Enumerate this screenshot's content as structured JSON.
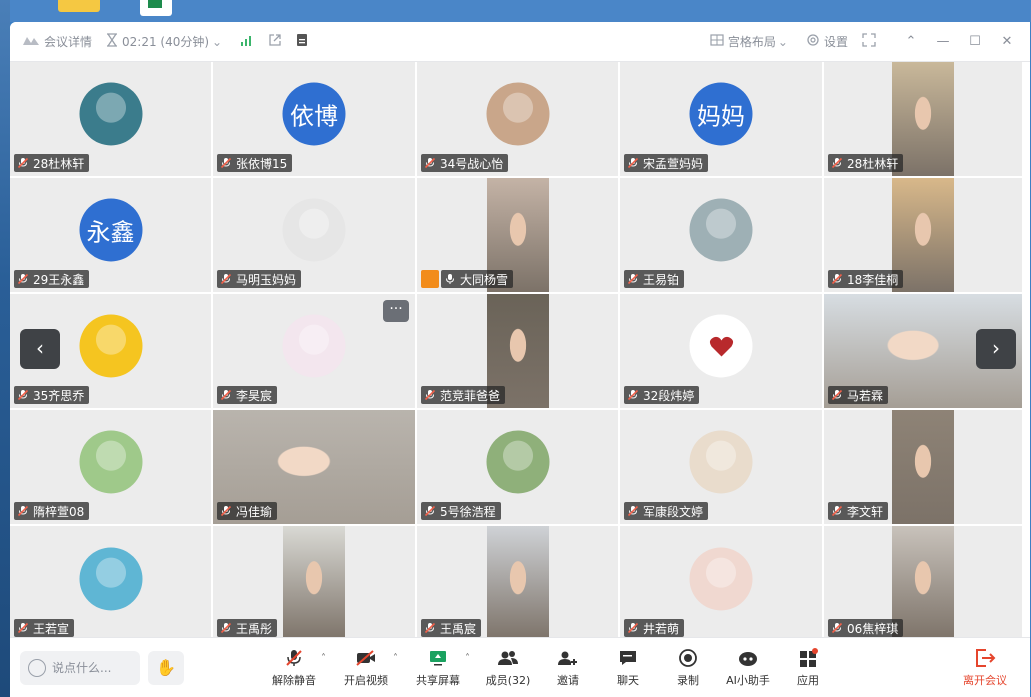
{
  "titlebar": {
    "meeting_details": "会议详情",
    "timer": "02:21 (40分钟)",
    "layout": "宫格布局",
    "settings": "设置"
  },
  "participants": [
    {
      "name": "28杜林轩",
      "type": "photo",
      "color": "#3b7c8c"
    },
    {
      "name": "张依博15",
      "type": "text",
      "avatar_text": "依博"
    },
    {
      "name": "34号战心怡",
      "type": "photo",
      "color": "#c9a68a"
    },
    {
      "name": "宋孟萱妈妈",
      "type": "text",
      "avatar_text": "妈妈"
    },
    {
      "name": "28杜林轩",
      "type": "video",
      "color": "#c9b89a"
    },
    {
      "name": "29王永鑫",
      "type": "text",
      "avatar_text": "永鑫"
    },
    {
      "name": "马明玉妈妈",
      "type": "photo",
      "color": "#e6e6e6"
    },
    {
      "name": "大同杨雪",
      "type": "video",
      "color": "#c4b3a6",
      "host": true,
      "mic_on": true
    },
    {
      "name": "王易铂",
      "type": "photo",
      "color": "#9eb0b5"
    },
    {
      "name": "18李佳桐",
      "type": "video",
      "color": "#d8b88a"
    },
    {
      "name": "35齐思乔",
      "type": "photo",
      "color": "#f5c520"
    },
    {
      "name": "李昊宸",
      "type": "photo",
      "color": "#f3e6ee"
    },
    {
      "name": "范竞菲爸爸",
      "type": "video",
      "color": "#6a6358"
    },
    {
      "name": "32段炜婷",
      "type": "heart"
    },
    {
      "name": "马若霖",
      "type": "video_wide",
      "color": "#d7dde2"
    },
    {
      "name": "隋梓萱08",
      "type": "photo",
      "color": "#9fc98a"
    },
    {
      "name": "冯佳瑜",
      "type": "video_wide",
      "color": "#b9b4ad"
    },
    {
      "name": "5号徐浩程",
      "type": "photo",
      "color": "#8fb07a"
    },
    {
      "name": "军康段文婷",
      "type": "photo",
      "color": "#e9dccc"
    },
    {
      "name": "李文轩",
      "type": "video",
      "color": "#8e8376"
    },
    {
      "name": "王若宣",
      "type": "photo",
      "color": "#5fb6d4"
    },
    {
      "name": "王禹彤",
      "type": "video",
      "color": "#d9d9d4"
    },
    {
      "name": "王禹宸",
      "type": "video",
      "color": "#cfd2d6"
    },
    {
      "name": "井若萌",
      "type": "photo",
      "color": "#f0d8d0"
    },
    {
      "name": "06焦梓琪",
      "type": "video",
      "color": "#c8c2bb"
    }
  ],
  "toolbar": {
    "chat_placeholder": "说点什么...",
    "unmute": "解除静音",
    "start_video": "开启视频",
    "share_screen": "共享屏幕",
    "members": "成员(32)",
    "invite": "邀请",
    "chat": "聊天",
    "record": "录制",
    "ai_assistant": "AI小助手",
    "apps": "应用",
    "leave": "离开会议"
  },
  "colors": {
    "accent": "#2f6fd1",
    "leave": "#e5452d",
    "host": "#f28c1a"
  }
}
